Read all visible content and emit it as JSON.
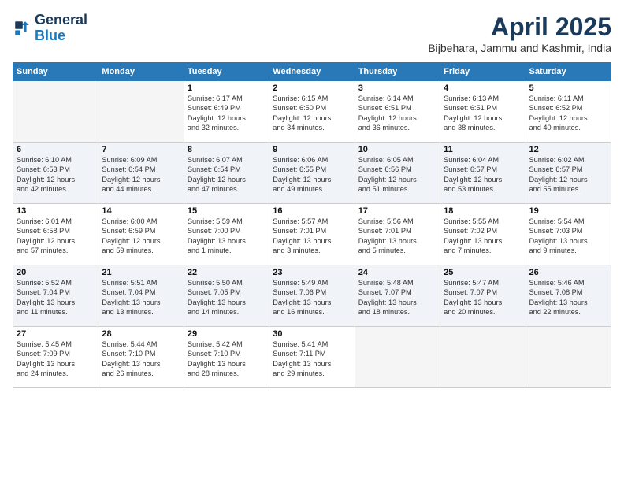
{
  "logo": {
    "line1": "General",
    "line2": "Blue"
  },
  "title": {
    "month_year": "April 2025",
    "location": "Bijbehara, Jammu and Kashmir, India"
  },
  "headers": [
    "Sunday",
    "Monday",
    "Tuesday",
    "Wednesday",
    "Thursday",
    "Friday",
    "Saturday"
  ],
  "weeks": [
    {
      "days": [
        {
          "num": "",
          "detail": ""
        },
        {
          "num": "",
          "detail": ""
        },
        {
          "num": "1",
          "detail": "Sunrise: 6:17 AM\nSunset: 6:49 PM\nDaylight: 12 hours\nand 32 minutes."
        },
        {
          "num": "2",
          "detail": "Sunrise: 6:15 AM\nSunset: 6:50 PM\nDaylight: 12 hours\nand 34 minutes."
        },
        {
          "num": "3",
          "detail": "Sunrise: 6:14 AM\nSunset: 6:51 PM\nDaylight: 12 hours\nand 36 minutes."
        },
        {
          "num": "4",
          "detail": "Sunrise: 6:13 AM\nSunset: 6:51 PM\nDaylight: 12 hours\nand 38 minutes."
        },
        {
          "num": "5",
          "detail": "Sunrise: 6:11 AM\nSunset: 6:52 PM\nDaylight: 12 hours\nand 40 minutes."
        }
      ]
    },
    {
      "days": [
        {
          "num": "6",
          "detail": "Sunrise: 6:10 AM\nSunset: 6:53 PM\nDaylight: 12 hours\nand 42 minutes."
        },
        {
          "num": "7",
          "detail": "Sunrise: 6:09 AM\nSunset: 6:54 PM\nDaylight: 12 hours\nand 44 minutes."
        },
        {
          "num": "8",
          "detail": "Sunrise: 6:07 AM\nSunset: 6:54 PM\nDaylight: 12 hours\nand 47 minutes."
        },
        {
          "num": "9",
          "detail": "Sunrise: 6:06 AM\nSunset: 6:55 PM\nDaylight: 12 hours\nand 49 minutes."
        },
        {
          "num": "10",
          "detail": "Sunrise: 6:05 AM\nSunset: 6:56 PM\nDaylight: 12 hours\nand 51 minutes."
        },
        {
          "num": "11",
          "detail": "Sunrise: 6:04 AM\nSunset: 6:57 PM\nDaylight: 12 hours\nand 53 minutes."
        },
        {
          "num": "12",
          "detail": "Sunrise: 6:02 AM\nSunset: 6:57 PM\nDaylight: 12 hours\nand 55 minutes."
        }
      ]
    },
    {
      "days": [
        {
          "num": "13",
          "detail": "Sunrise: 6:01 AM\nSunset: 6:58 PM\nDaylight: 12 hours\nand 57 minutes."
        },
        {
          "num": "14",
          "detail": "Sunrise: 6:00 AM\nSunset: 6:59 PM\nDaylight: 12 hours\nand 59 minutes."
        },
        {
          "num": "15",
          "detail": "Sunrise: 5:59 AM\nSunset: 7:00 PM\nDaylight: 13 hours\nand 1 minute."
        },
        {
          "num": "16",
          "detail": "Sunrise: 5:57 AM\nSunset: 7:01 PM\nDaylight: 13 hours\nand 3 minutes."
        },
        {
          "num": "17",
          "detail": "Sunrise: 5:56 AM\nSunset: 7:01 PM\nDaylight: 13 hours\nand 5 minutes."
        },
        {
          "num": "18",
          "detail": "Sunrise: 5:55 AM\nSunset: 7:02 PM\nDaylight: 13 hours\nand 7 minutes."
        },
        {
          "num": "19",
          "detail": "Sunrise: 5:54 AM\nSunset: 7:03 PM\nDaylight: 13 hours\nand 9 minutes."
        }
      ]
    },
    {
      "days": [
        {
          "num": "20",
          "detail": "Sunrise: 5:52 AM\nSunset: 7:04 PM\nDaylight: 13 hours\nand 11 minutes."
        },
        {
          "num": "21",
          "detail": "Sunrise: 5:51 AM\nSunset: 7:04 PM\nDaylight: 13 hours\nand 13 minutes."
        },
        {
          "num": "22",
          "detail": "Sunrise: 5:50 AM\nSunset: 7:05 PM\nDaylight: 13 hours\nand 14 minutes."
        },
        {
          "num": "23",
          "detail": "Sunrise: 5:49 AM\nSunset: 7:06 PM\nDaylight: 13 hours\nand 16 minutes."
        },
        {
          "num": "24",
          "detail": "Sunrise: 5:48 AM\nSunset: 7:07 PM\nDaylight: 13 hours\nand 18 minutes."
        },
        {
          "num": "25",
          "detail": "Sunrise: 5:47 AM\nSunset: 7:07 PM\nDaylight: 13 hours\nand 20 minutes."
        },
        {
          "num": "26",
          "detail": "Sunrise: 5:46 AM\nSunset: 7:08 PM\nDaylight: 13 hours\nand 22 minutes."
        }
      ]
    },
    {
      "days": [
        {
          "num": "27",
          "detail": "Sunrise: 5:45 AM\nSunset: 7:09 PM\nDaylight: 13 hours\nand 24 minutes."
        },
        {
          "num": "28",
          "detail": "Sunrise: 5:44 AM\nSunset: 7:10 PM\nDaylight: 13 hours\nand 26 minutes."
        },
        {
          "num": "29",
          "detail": "Sunrise: 5:42 AM\nSunset: 7:10 PM\nDaylight: 13 hours\nand 28 minutes."
        },
        {
          "num": "30",
          "detail": "Sunrise: 5:41 AM\nSunset: 7:11 PM\nDaylight: 13 hours\nand 29 minutes."
        },
        {
          "num": "",
          "detail": ""
        },
        {
          "num": "",
          "detail": ""
        },
        {
          "num": "",
          "detail": ""
        }
      ]
    }
  ]
}
